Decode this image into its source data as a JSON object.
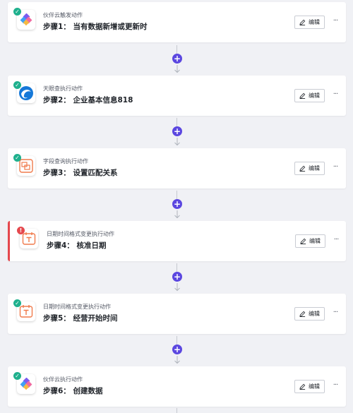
{
  "colors": {
    "accent": "#5b47e0",
    "success": "#1fb08d",
    "error": "#e5484d",
    "card_border_error": "#e5484d",
    "icon_orange": "#f07a4b"
  },
  "steps": [
    {
      "app": "伙伴云触发动作",
      "title": "步骤1： 当有数据新增或更新时",
      "status": "success",
      "icon": "huoban-logo-icon",
      "edit": "编辑",
      "more": "···"
    },
    {
      "app": "天眼查执行动作",
      "title": "步骤2： 企业基本信息818",
      "status": "success",
      "icon": "tianyancha-logo-icon",
      "edit": "编辑",
      "more": "···"
    },
    {
      "app": "字段查询执行动作",
      "title": "步骤3： 设置匹配关系",
      "status": "success",
      "icon": "field-query-icon",
      "edit": "编辑",
      "more": "···"
    },
    {
      "app": "日期时间格式变更执行动作",
      "title": "步骤4： 核准日期",
      "status": "error",
      "icon": "calendar-icon",
      "edit": "编辑",
      "more": "···"
    },
    {
      "app": "日期时间格式变更执行动作",
      "title": "步骤5： 经营开始时间",
      "status": "success",
      "icon": "calendar-icon",
      "edit": "编辑",
      "more": "···"
    },
    {
      "app": "伙伴云执行动作",
      "title": "步骤6： 创建数据",
      "status": "success",
      "icon": "huoban-logo-icon",
      "edit": "编辑",
      "more": "···"
    }
  ],
  "add_symbol": "+"
}
